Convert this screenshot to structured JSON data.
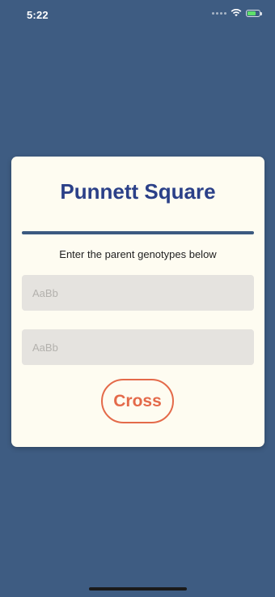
{
  "status_bar": {
    "time": "5:22"
  },
  "card": {
    "title": "Punnett Square",
    "instruction": "Enter the parent genotypes below",
    "input_1": {
      "value": "",
      "placeholder": "AaBb"
    },
    "input_2": {
      "value": "",
      "placeholder": "AaBb"
    },
    "button_label": "Cross"
  },
  "colors": {
    "background": "#3e5c82",
    "card": "#fefcf1",
    "title": "#2b4088",
    "accent": "#e46a4a",
    "input_bg": "#e5e3df"
  },
  "icons": [
    "signal-dots-icon",
    "wifi-icon",
    "battery-icon"
  ]
}
